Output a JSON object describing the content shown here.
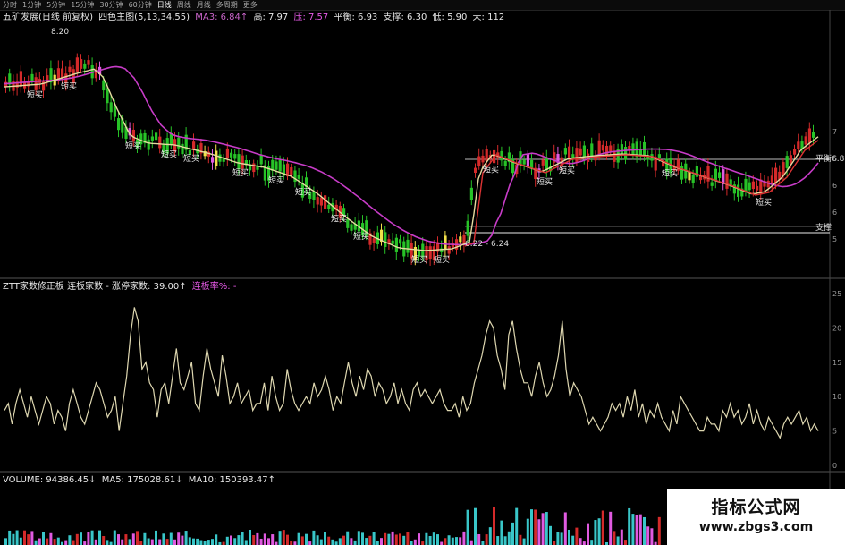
{
  "toolbar": {
    "items": [
      "分时",
      "1分钟",
      "5分钟",
      "15分钟",
      "30分钟",
      "60分钟",
      "日线",
      "周线",
      "月线",
      "多周期",
      "更多"
    ],
    "active_index": 6
  },
  "price_panel": {
    "title": "五矿发展(日线 前复权)",
    "indicator": "四色主图(5,13,34,55)",
    "ma3_label": "MA3: 6.84↑",
    "high": "高: 7.97",
    "pressure": "压: 7.57",
    "balance": "平衡: 6.93",
    "support": "支撑: 6.30",
    "low": "低: 5.90",
    "days": "天: 112",
    "peak_label": "8.20",
    "range_label": "6.22 - 6.24",
    "signal_label": "短买",
    "right_label_balance": "平衡6.8",
    "right_label_support": "支撑",
    "right_axis": [
      "7",
      "6",
      "6",
      "6",
      "5"
    ]
  },
  "sub_panel": {
    "title": "ZTT家数修正板 连板家数 - 涨停家数: 39.00↑",
    "title2": "连板率%: -",
    "right_axis": [
      "25",
      "20",
      "15",
      "10",
      "5",
      "0"
    ]
  },
  "volume_panel": {
    "title": "VOLUME: 94386.45↓",
    "ma5": "MA5: 175028.61↓",
    "ma10": "MA10: 150393.47↑"
  },
  "watermark": {
    "line1": "指标公式网",
    "line2": "www.zbgs3.com"
  },
  "colors": {
    "up": "#d42a2a",
    "down": "#27c227",
    "ma_fast": "#e6dba0",
    "ma_slow": "#c83cc8",
    "ma_red": "#dd3333",
    "oscillator": "#ded7b0",
    "volume_cyan": "#39c6c8"
  },
  "chart_data": {
    "type": "line",
    "title": "ZTT家数修正板 连板家数 - 涨停家数",
    "ylabel": "",
    "ylim": [
      0,
      25
    ],
    "values": [
      8,
      9,
      6,
      9,
      11,
      9,
      7,
      10,
      8,
      6,
      8,
      10,
      9,
      6,
      8,
      7,
      5,
      9,
      11,
      9,
      7,
      6,
      8,
      10,
      12,
      11,
      9,
      7,
      8,
      10,
      5,
      9,
      13,
      19,
      23,
      21,
      14,
      15,
      12,
      11,
      7,
      11,
      12,
      9,
      13,
      17,
      12,
      11,
      13,
      15,
      9,
      8,
      13,
      17,
      14,
      12,
      10,
      16,
      13,
      9,
      10,
      12,
      9,
      10,
      11,
      8,
      9,
      9,
      12,
      8,
      13,
      10,
      8,
      9,
      14,
      11,
      9,
      8,
      9,
      10,
      9,
      12,
      10,
      11,
      13,
      11,
      8,
      10,
      9,
      12,
      15,
      12,
      10,
      13,
      11,
      14,
      13,
      10,
      12,
      11,
      9,
      10,
      12,
      9,
      11,
      9,
      8,
      11,
      12,
      10,
      11,
      10,
      9,
      10,
      11,
      9,
      8,
      8,
      9,
      7,
      10,
      8,
      9,
      12,
      14,
      16,
      19,
      21,
      20,
      16,
      14,
      11,
      19,
      21,
      17,
      14,
      12,
      12,
      10,
      13,
      15,
      12,
      10,
      11,
      13,
      16,
      21,
      14,
      10,
      12,
      11,
      10,
      8,
      6,
      7,
      6,
      5,
      6,
      7,
      9,
      8,
      9,
      7,
      10,
      8,
      11,
      7,
      9,
      6,
      8,
      7,
      9,
      7,
      6,
      5,
      8,
      6,
      10,
      9,
      8,
      7,
      6,
      5,
      5,
      7,
      6,
      6,
      5,
      8,
      7,
      9,
      7,
      8,
      6,
      7,
      9,
      6,
      8,
      6,
      5,
      7,
      6,
      5,
      4,
      6,
      7,
      6,
      7,
      8,
      6,
      7,
      5,
      6,
      5
    ],
    "series_name": "连板家数 - 涨停家数",
    "grid": false
  }
}
